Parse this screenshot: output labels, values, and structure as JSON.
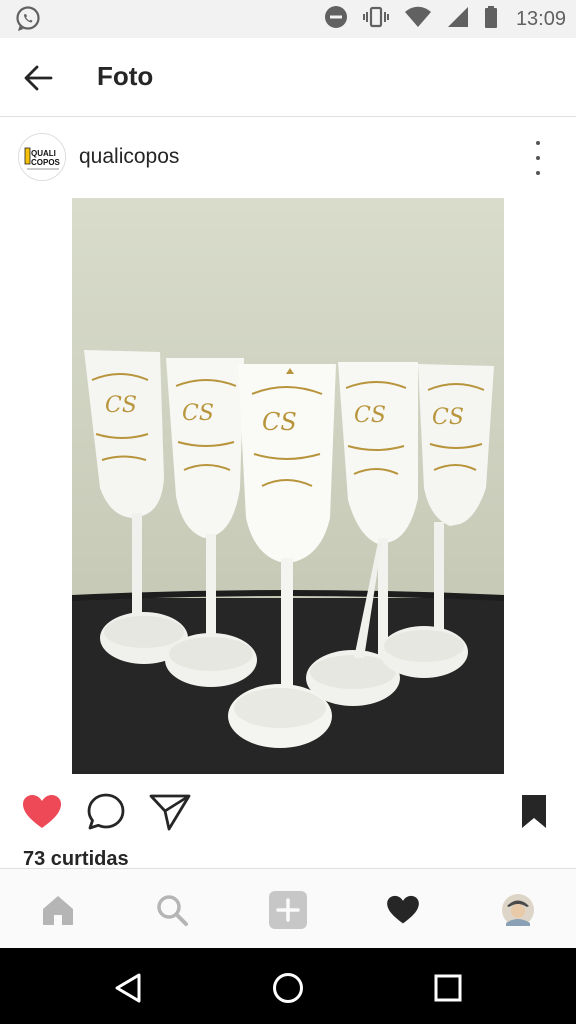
{
  "status_bar": {
    "time": "13:09",
    "icons": [
      "whatsapp-icon",
      "do-not-disturb-icon",
      "vibrate-icon",
      "wifi-icon",
      "signal-icon",
      "battery-icon"
    ]
  },
  "app_bar": {
    "title": "Foto",
    "back_icon": "arrow-back-icon"
  },
  "post": {
    "username": "qualicopos",
    "avatar_logo_text": "QUALI COPOS",
    "menu_icon": "more-vertical-icon",
    "photo_monogram": "CS",
    "liked": true,
    "likes_text": "73 curtidas",
    "actions": [
      "heart-icon",
      "comment-icon",
      "share-icon",
      "bookmark-icon"
    ]
  },
  "bottom_nav": {
    "items": [
      "home-icon",
      "search-icon",
      "add-post-icon",
      "activity-heart-icon",
      "profile-avatar-icon"
    ]
  },
  "system_nav": {
    "items": [
      "back-triangle-icon",
      "home-circle-icon",
      "recents-square-icon"
    ]
  },
  "colors": {
    "like_red": "#ed4956",
    "text": "#262626",
    "status_bar_bg": "#f2f2f2",
    "nav_bg": "#fafafa",
    "gold": "#b8953c"
  }
}
